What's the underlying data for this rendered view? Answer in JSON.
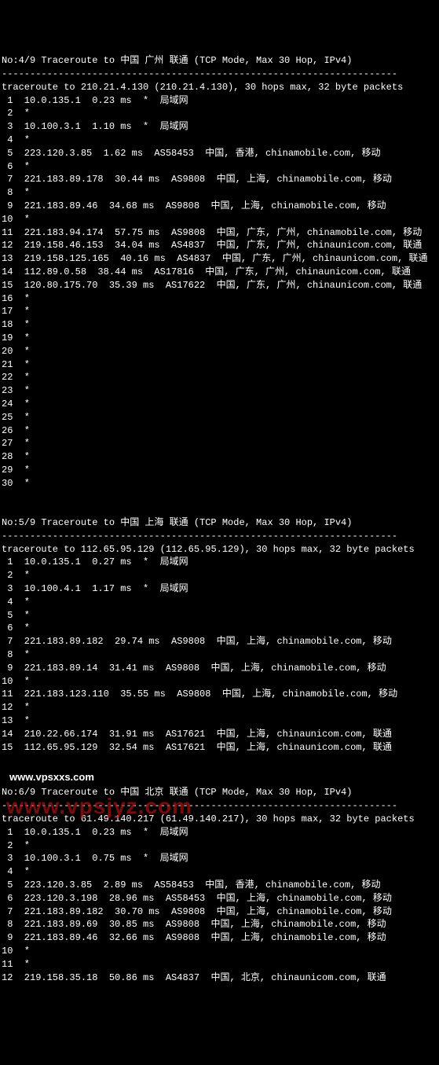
{
  "dashline": "----------------------------------------------------------------------",
  "watermark1": "www.vpsxxs.com",
  "watermark2": "www.vpsjyz.com",
  "sections": [
    {
      "header": "No:4/9 Traceroute to 中国 广州 联通 (TCP Mode, Max 30 Hop, IPv4)",
      "traceline": "traceroute to 210.21.4.130 (210.21.4.130), 30 hops max, 32 byte packets",
      "hops": [
        " 1  10.0.135.1  0.23 ms  *  局域网",
        " 2  *",
        " 3  10.100.3.1  1.10 ms  *  局域网",
        " 4  *",
        " 5  223.120.3.85  1.62 ms  AS58453  中国, 香港, chinamobile.com, 移动",
        " 6  *",
        " 7  221.183.89.178  30.44 ms  AS9808  中国, 上海, chinamobile.com, 移动",
        " 8  *",
        " 9  221.183.89.46  34.68 ms  AS9808  中国, 上海, chinamobile.com, 移动",
        "10  *",
        "11  221.183.94.174  57.75 ms  AS9808  中国, 广东, 广州, chinamobile.com, 移动",
        "12  219.158.46.153  34.04 ms  AS4837  中国, 广东, 广州, chinaunicom.com, 联通",
        "13  219.158.125.165  40.16 ms  AS4837  中国, 广东, 广州, chinaunicom.com, 联通",
        "14  112.89.0.58  38.44 ms  AS17816  中国, 广东, 广州, chinaunicom.com, 联通",
        "15  120.80.175.70  35.39 ms  AS17622  中国, 广东, 广州, chinaunicom.com, 联通",
        "16  *",
        "17  *",
        "18  *",
        "19  *",
        "20  *",
        "21  *",
        "22  *",
        "23  *",
        "24  *",
        "25  *",
        "26  *",
        "27  *",
        "28  *",
        "29  *",
        "30  *"
      ]
    },
    {
      "header": "No:5/9 Traceroute to 中国 上海 联通 (TCP Mode, Max 30 Hop, IPv4)",
      "traceline": "traceroute to 112.65.95.129 (112.65.95.129), 30 hops max, 32 byte packets",
      "hops": [
        " 1  10.0.135.1  0.27 ms  *  局域网",
        " 2  *",
        " 3  10.100.4.1  1.17 ms  *  局域网",
        " 4  *",
        " 5  *",
        " 6  *",
        " 7  221.183.89.182  29.74 ms  AS9808  中国, 上海, chinamobile.com, 移动",
        " 8  *",
        " 9  221.183.89.14  31.41 ms  AS9808  中国, 上海, chinamobile.com, 移动",
        "10  *",
        "11  221.183.123.110  35.55 ms  AS9808  中国, 上海, chinamobile.com, 移动",
        "12  *",
        "13  *",
        "14  210.22.66.174  31.91 ms  AS17621  中国, 上海, chinaunicom.com, 联通",
        "15  112.65.95.129  32.54 ms  AS17621  中国, 上海, chinaunicom.com, 联通"
      ]
    },
    {
      "header": "No:6/9 Traceroute to 中国 北京 联通 (TCP Mode, Max 30 Hop, IPv4)",
      "traceline": "traceroute to 61.49.140.217 (61.49.140.217), 30 hops max, 32 byte packets",
      "hops": [
        " 1  10.0.135.1  0.23 ms  *  局域网",
        " 2  *",
        " 3  10.100.3.1  0.75 ms  *  局域网",
        " 4  *",
        " 5  223.120.3.85  2.89 ms  AS58453  中国, 香港, chinamobile.com, 移动",
        " 6  223.120.3.198  28.96 ms  AS58453  中国, 上海, chinamobile.com, 移动",
        " 7  221.183.89.182  30.70 ms  AS9808  中国, 上海, chinamobile.com, 移动",
        " 8  221.183.89.69  30.85 ms  AS9808  中国, 上海, chinamobile.com, 移动",
        " 9  221.183.89.46  32.66 ms  AS9808  中国, 上海, chinamobile.com, 移动",
        "10  *",
        "11  *",
        "12  219.158.35.18  50.86 ms  AS4837  中国, 北京, chinaunicom.com, 联通"
      ]
    }
  ]
}
